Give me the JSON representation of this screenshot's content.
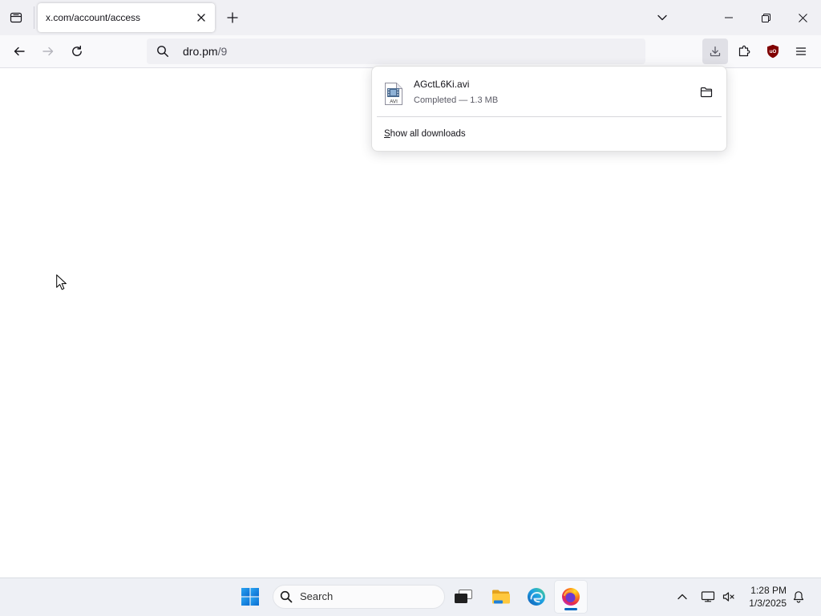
{
  "window": {
    "firefox_view_icon": "firefox-view-icon",
    "tabs": [
      {
        "title": "x.com/account/access",
        "active": true,
        "close_icon": "close-icon"
      }
    ],
    "new_tab_icon": "plus-icon",
    "list_tabs_icon": "chevron-down-icon",
    "controls": [
      "minimize-icon",
      "restore-icon",
      "close-icon"
    ]
  },
  "toolbar": {
    "nav_buttons": [
      {
        "icon": "back-arrow-icon",
        "enabled": true
      },
      {
        "icon": "forward-arrow-icon",
        "enabled": false
      },
      {
        "icon": "reload-icon",
        "enabled": true
      }
    ],
    "urlbar": {
      "icon": "search-icon",
      "host": "dro.pm",
      "path": "/9"
    },
    "right_buttons": [
      {
        "icon": "download-icon",
        "open": true
      },
      {
        "icon": "puzzle-extensions-icon"
      },
      {
        "icon": "ublock-origin-shield-icon",
        "logo_lettering": "uO"
      },
      {
        "icon": "hamburger-menu-icon"
      }
    ]
  },
  "downloads_panel": {
    "items": [
      {
        "file_icon": "avi-file-icon",
        "file_icon_label": "AVI",
        "filename": "AGctL6Ki.avi",
        "status": "Completed — 1.3 MB",
        "action_icon": "folder-icon"
      }
    ],
    "show_all_label": "Show all downloads"
  },
  "taskbar": {
    "start_icon": "windows-start-icon",
    "search": {
      "icon": "search-icon",
      "label": "Search"
    },
    "apps": [
      {
        "icon": "task-view-icon",
        "active": false
      },
      {
        "icon": "file-explorer-icon",
        "active": false
      },
      {
        "icon": "edge-icon",
        "active": false
      },
      {
        "icon": "firefox-icon",
        "active": true
      }
    ],
    "tray": {
      "icons": [
        "chevron-up-icon",
        "network-icon",
        "volume-muted-icon",
        "notification-bell-icon"
      ],
      "time": "1:28 PM",
      "date": "1/3/2025"
    }
  },
  "colors": {
    "tabstrip-bg": "#f0f0f4",
    "toolbar-bg": "#f9f9fb",
    "urlbar-bg": "#f0f0f4",
    "text": "#15141a",
    "text-dim": "#5b5b66",
    "taskbar-bg": "#eef0f5",
    "accent": "#0067c0",
    "ublock-red": "#800000"
  }
}
